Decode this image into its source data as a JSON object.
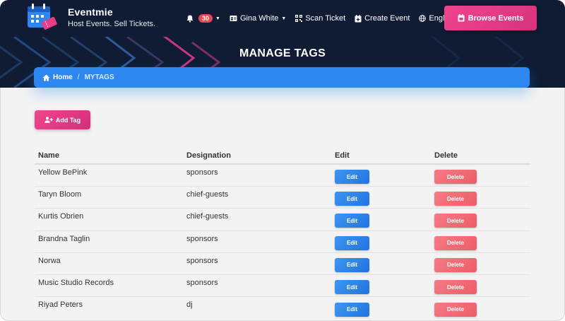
{
  "app": {
    "name": "Eventmie",
    "tagline": "Host Events. Sell Tickets."
  },
  "nav": {
    "notifications_count": "30",
    "user_name": "Gina White",
    "scan_ticket": "Scan Ticket",
    "create_event": "Create Event",
    "language": "English",
    "browse_events": "Browse Events"
  },
  "page": {
    "title": "MANAGE TAGS"
  },
  "breadcrumb": {
    "home": "Home",
    "separator": "/",
    "current": "MYTAGS"
  },
  "actions": {
    "add_tag": "Add Tag"
  },
  "table": {
    "headers": {
      "name": "Name",
      "designation": "Designation",
      "edit": "Edit",
      "delete": "Delete"
    },
    "edit_label": "Edit",
    "delete_label": "Delete",
    "rows": [
      {
        "name": "Yellow BePink",
        "designation": "sponsors"
      },
      {
        "name": "Taryn Bloom",
        "designation": "chief-guests"
      },
      {
        "name": "Kurtis Obrien",
        "designation": "chief-guests"
      },
      {
        "name": "Brandna Taglin",
        "designation": "sponsors"
      },
      {
        "name": "Norwa",
        "designation": "sponsors"
      },
      {
        "name": "Music Studio Records",
        "designation": "sponsors"
      },
      {
        "name": "Riyad Peters",
        "designation": "dj"
      }
    ]
  },
  "colors": {
    "navbar_bg": "#0f1c33",
    "pink_accent": "#e93b86",
    "breadcrumb_blue": "#2e86f0",
    "edit_blue": "#2a80e8",
    "delete_red": "#f06a75"
  }
}
